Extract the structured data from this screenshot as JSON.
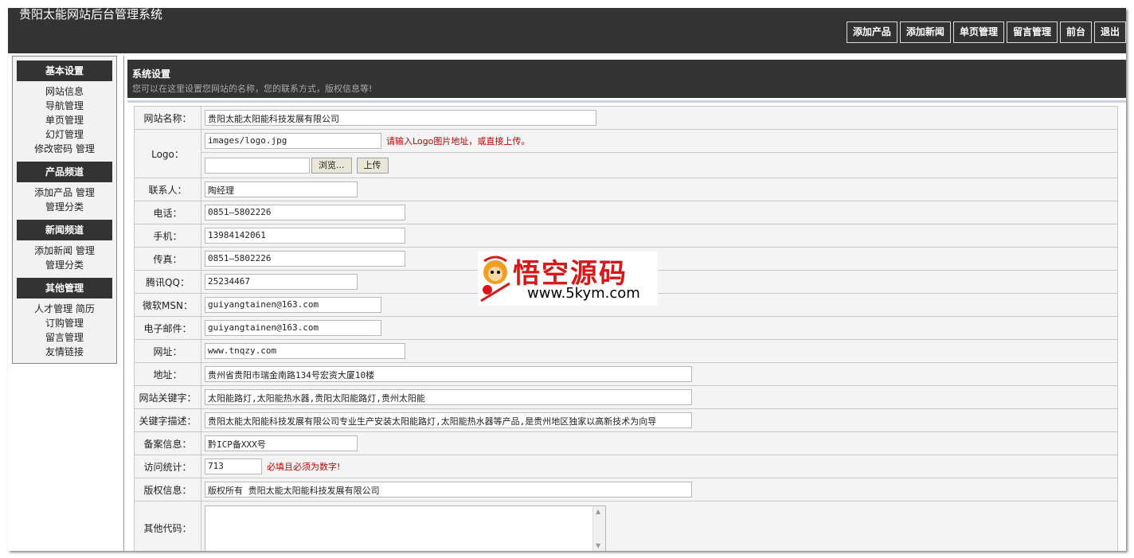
{
  "header": {
    "title": "贵阳太能网站后台管理系统",
    "nav": [
      "添加产品",
      "添加新闻",
      "单页管理",
      "留言管理",
      "前台",
      "退出"
    ]
  },
  "sidebar": {
    "groups": [
      {
        "title": "基本设置",
        "lines": [
          [
            "网站信息"
          ],
          [
            "导航管理"
          ],
          [
            "单页管理"
          ],
          [
            "幻灯管理"
          ],
          [
            "修改密码",
            "管理"
          ]
        ]
      },
      {
        "title": "产品频道",
        "lines": [
          [
            "添加产品",
            "管理"
          ],
          [
            "管理分类"
          ]
        ]
      },
      {
        "title": "新闻频道",
        "lines": [
          [
            "添加新闻",
            "管理"
          ],
          [
            "管理分类"
          ]
        ]
      },
      {
        "title": "其他管理",
        "lines": [
          [
            "人才管理",
            "简历"
          ],
          [
            "订购管理"
          ],
          [
            "留言管理"
          ],
          [
            "友情链接"
          ]
        ]
      }
    ]
  },
  "main": {
    "title": "系统设置",
    "desc": "您可以在这里设置您网站的名称，您的联系方式，版权信息等!",
    "fields": {
      "site_name": {
        "label": "网站名称：",
        "value": "贵阳太能太阳能科技发展有限公司"
      },
      "logo": {
        "label": "Logo：",
        "value": "images/logo.jpg",
        "hint": "请输入Logo图片地址，或直接上传。",
        "file_value": "",
        "browse": "浏览...",
        "upload": "上传"
      },
      "contact": {
        "label": "联系人：",
        "value": "陶经理"
      },
      "phone": {
        "label": "电话：",
        "value": "0851—5802226"
      },
      "mobile": {
        "label": "手机：",
        "value": "13984142061"
      },
      "fax": {
        "label": "传真：",
        "value": "0851—5802226"
      },
      "qq": {
        "label": "腾讯QQ：",
        "value": "25234467"
      },
      "msn": {
        "label": "微软MSN：",
        "value": "guiyangtainen@163.com"
      },
      "email": {
        "label": "电子邮件：",
        "value": "guiyangtainen@163.com"
      },
      "url": {
        "label": "网址：",
        "value": "www.tnqzy.com"
      },
      "address": {
        "label": "地址：",
        "value": "贵州省贵阳市瑞金南路134号宏资大厦10楼"
      },
      "keywords": {
        "label": "网站关键字：",
        "value": "太阳能路灯,太阳能热水器,贵阳太阳能路灯,贵州太阳能"
      },
      "description": {
        "label": "关键字描述：",
        "value": "贵阳太能太阳能科技发展有限公司专业生产安装太阳能路灯,太阳能热水器等产品,是贵州地区独家以高新技术为向导"
      },
      "icp": {
        "label": "备案信息：",
        "value": "黔ICP备XXX号"
      },
      "stats": {
        "label": "访问统计：",
        "value": "713",
        "hint": "必填且必须为数字!"
      },
      "copyright": {
        "label": "版权信息：",
        "value": "版权所有 贵阳太能太阳能科技发展有限公司"
      },
      "other_code": {
        "label": "其他代码：",
        "value": ""
      }
    }
  },
  "watermark": {
    "text": "悟空源码",
    "url": "www.5kym.com"
  }
}
